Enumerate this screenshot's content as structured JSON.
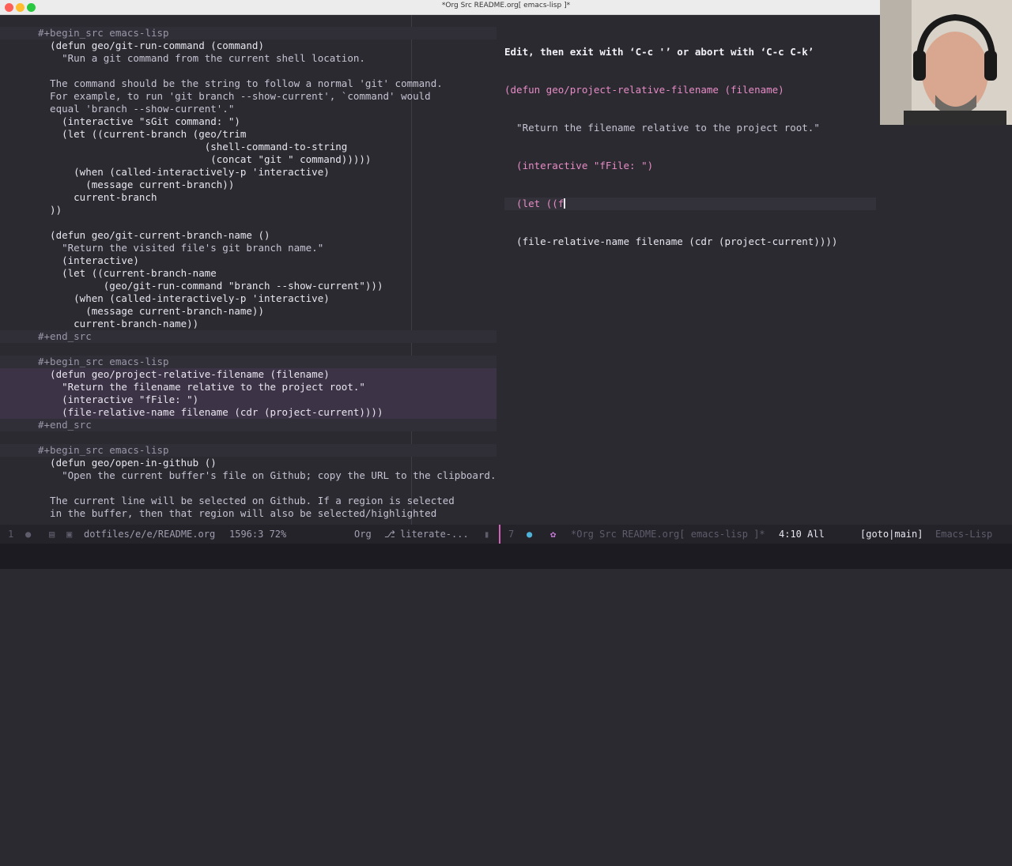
{
  "window": {
    "title": "*Org Src README.org[ emacs-lisp ]*"
  },
  "left_pane": {
    "lines": [
      {
        "cls": "meta",
        "text": "#+begin_src emacs-lisp"
      },
      {
        "cls": "plain",
        "text": "  (defun geo/git-run-command (command)"
      },
      {
        "cls": "doc",
        "text": "    \"Run a git command from the current shell location."
      },
      {
        "cls": "plain",
        "text": ""
      },
      {
        "cls": "doc",
        "text": "  The command should be the string to follow a normal 'git' command."
      },
      {
        "cls": "doc",
        "text": "  For example, to run 'git branch --show-current', `command' would"
      },
      {
        "cls": "doc",
        "text": "  equal 'branch --show-current'.\""
      },
      {
        "cls": "plain",
        "text": "    (interactive \"sGit command: \")"
      },
      {
        "cls": "plain",
        "text": "    (let ((current-branch (geo/trim"
      },
      {
        "cls": "plain",
        "text": "                            (shell-command-to-string"
      },
      {
        "cls": "plain",
        "text": "                             (concat \"git \" command)))))"
      },
      {
        "cls": "plain",
        "text": "      (when (called-interactively-p 'interactive)"
      },
      {
        "cls": "plain",
        "text": "        (message current-branch))"
      },
      {
        "cls": "plain",
        "text": "      current-branch"
      },
      {
        "cls": "plain",
        "text": "  ))"
      },
      {
        "cls": "plain",
        "text": ""
      },
      {
        "cls": "plain",
        "text": "  (defun geo/git-current-branch-name ()"
      },
      {
        "cls": "doc",
        "text": "    \"Return the visited file's git branch name.\""
      },
      {
        "cls": "plain",
        "text": "    (interactive)"
      },
      {
        "cls": "plain",
        "text": "    (let ((current-branch-name"
      },
      {
        "cls": "plain",
        "text": "           (geo/git-run-command \"branch --show-current\")))"
      },
      {
        "cls": "plain",
        "text": "      (when (called-interactively-p 'interactive)"
      },
      {
        "cls": "plain",
        "text": "        (message current-branch-name))"
      },
      {
        "cls": "plain",
        "text": "      current-branch-name))"
      },
      {
        "cls": "meta",
        "text": "#+end_src"
      },
      {
        "cls": "plain",
        "text": ""
      },
      {
        "cls": "meta",
        "text": "#+begin_src emacs-lisp"
      },
      {
        "cls": "hl",
        "text": "  (defun geo/project-relative-filename (filename)"
      },
      {
        "cls": "hl",
        "text": "    \"Return the filename relative to the project root.\""
      },
      {
        "cls": "hl",
        "text": "    (interactive \"fFile: \")"
      },
      {
        "cls": "hl",
        "text": "    (file-relative-name filename (cdr (project-current))))"
      },
      {
        "cls": "meta",
        "text": "#+end_src"
      },
      {
        "cls": "plain",
        "text": ""
      },
      {
        "cls": "meta",
        "text": "#+begin_src emacs-lisp"
      },
      {
        "cls": "plain",
        "text": "  (defun geo/open-in-github ()"
      },
      {
        "cls": "doc",
        "text": "    \"Open the current buffer's file on Github; copy the URL to the clipboard."
      },
      {
        "cls": "plain",
        "text": ""
      },
      {
        "cls": "doc",
        "text": "  The current line will be selected on Github. If a region is selected"
      },
      {
        "cls": "doc",
        "text": "  in the buffer, then that region will also be selected/highlighted"
      }
    ]
  },
  "right_pane": {
    "header": "Edit, then exit with ‘C-c '’ or abort with ‘C-c C-k’",
    "lines": [
      "(defun geo/project-relative-filename (filename)",
      "  \"Return the filename relative to the project root.\"",
      "  (interactive \"fFile: \")",
      "  (let ((f",
      "  (file-relative-name filename (cdr (project-current))))"
    ]
  },
  "modeline": {
    "left_line_no": "1",
    "file": "dotfiles/e/e/README.org",
    "position": "1596:3 72%",
    "mode": "Org",
    "branch": "literate-...",
    "right_num": "7",
    "buffer": "*Org Src README.org[ emacs-lisp ]*",
    "right_position": "4:10 All",
    "git": "[goto|main]",
    "right_mode": "Emacs-Lisp"
  },
  "colors": {
    "background": "#2b2a31",
    "highlight": "#3d3347",
    "keyword": "#e78cc6",
    "separator": "#d060b8"
  }
}
